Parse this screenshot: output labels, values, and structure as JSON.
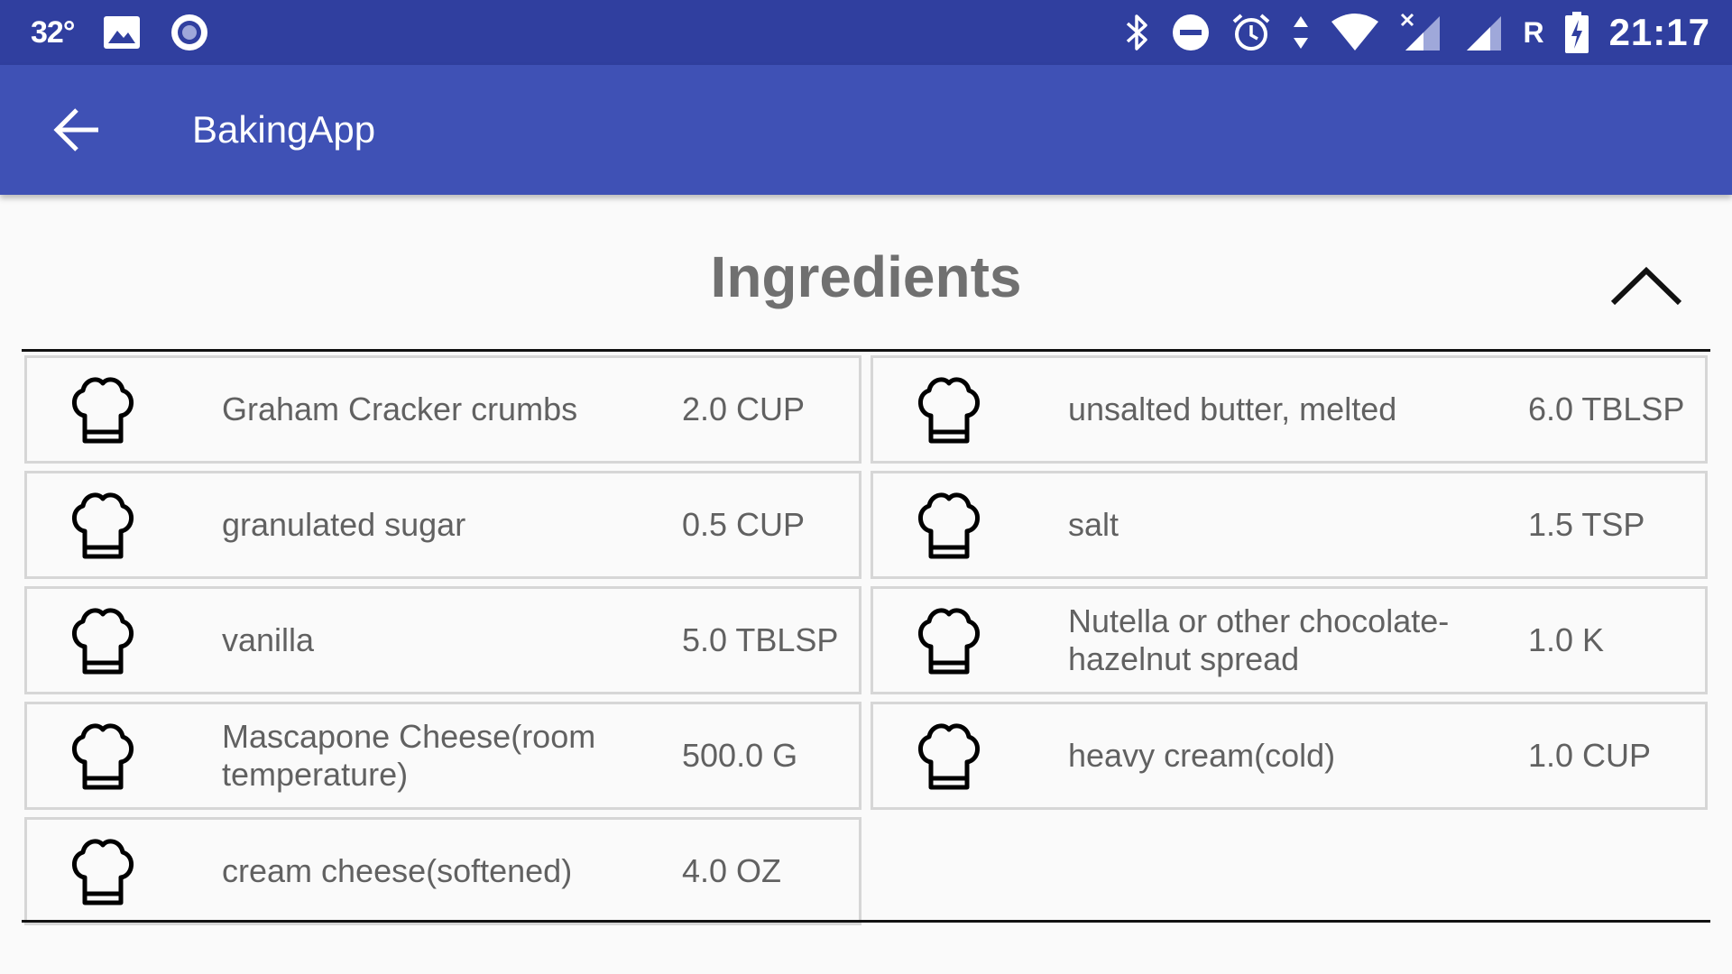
{
  "status_bar": {
    "temperature": "32°",
    "carrier": "R",
    "time": "21:17",
    "icons": [
      "image-icon",
      "record-icon",
      "bluetooth-icon",
      "do-not-disturb-icon",
      "alarm-icon",
      "data-transfer-icon",
      "wifi-icon",
      "signal-no-sim-icon",
      "signal-icon",
      "battery-charging-icon"
    ]
  },
  "app_bar": {
    "title": "BakingApp",
    "back_icon": "arrow-back-icon"
  },
  "section": {
    "title": "Ingredients",
    "collapse_icon": "chevron-up-icon"
  },
  "ingredients": [
    {
      "name": "Graham Cracker crumbs",
      "quantity": "2.0 CUP"
    },
    {
      "name": "unsalted butter, melted",
      "quantity": "6.0 TBLSP"
    },
    {
      "name": "granulated sugar",
      "quantity": "0.5 CUP"
    },
    {
      "name": "salt",
      "quantity": "1.5 TSP"
    },
    {
      "name": "vanilla",
      "quantity": "5.0 TBLSP"
    },
    {
      "name": "Nutella or other chocolate-hazelnut spread",
      "quantity": "1.0 K"
    },
    {
      "name": "Mascapone Cheese(room temperature)",
      "quantity": "500.0 G"
    },
    {
      "name": "heavy cream(cold)",
      "quantity": "1.0 CUP"
    },
    {
      "name": "cream cheese(softened)",
      "quantity": "4.0 OZ"
    }
  ],
  "item_icon": "chef-hat-icon",
  "colors": {
    "status_bar": "#303f9f",
    "app_bar": "#3f51b5",
    "background": "#fafafa",
    "card_border": "#d6d6d6",
    "text": "#616161",
    "title": "#707070"
  }
}
